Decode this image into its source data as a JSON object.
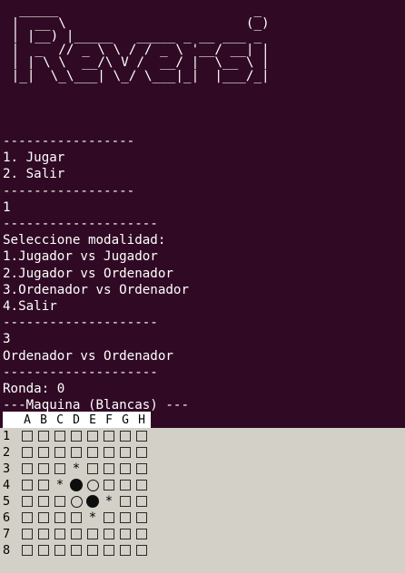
{
  "banner": "  _____                         _ \n |  __ \\                       (_)\n | |__) |_____   _____ _ __ ___ _ \n |  _  // _ \\ \\ / / _ \\ '__/ __| |\n | | \\ \\  __/\\ V /  __/ |  \\__ \\ |\n |_|  \\_\\___| \\_/ \\___|_|  |___/_|",
  "log": [
    "-----------------",
    "1. Jugar",
    "2. Salir",
    "-----------------",
    "1",
    "--------------------",
    "Seleccione modalidad:",
    "1.Jugador vs Jugador",
    "2.Jugador vs Ordenador",
    "3.Ordenador vs Ordenador",
    "4.Salir",
    "--------------------",
    "3",
    "Ordenador vs Ordenador",
    "--------------------",
    "Ronda: 0",
    "---Maquina (Blancas) ---"
  ],
  "board": {
    "columns": [
      "A",
      "B",
      "C",
      "D",
      "E",
      "F",
      "G",
      "H"
    ],
    "rows": [
      {
        "label": "1",
        "cells": [
          "empty",
          "empty",
          "empty",
          "empty",
          "empty",
          "empty",
          "empty",
          "empty"
        ]
      },
      {
        "label": "2",
        "cells": [
          "empty",
          "empty",
          "empty",
          "empty",
          "empty",
          "empty",
          "empty",
          "empty"
        ]
      },
      {
        "label": "3",
        "cells": [
          "empty",
          "empty",
          "empty",
          "hint",
          "empty",
          "empty",
          "empty",
          "empty"
        ]
      },
      {
        "label": "4",
        "cells": [
          "empty",
          "empty",
          "hint",
          "black",
          "white",
          "empty",
          "empty",
          "empty"
        ]
      },
      {
        "label": "5",
        "cells": [
          "empty",
          "empty",
          "empty",
          "white",
          "black",
          "hint",
          "empty",
          "empty"
        ]
      },
      {
        "label": "6",
        "cells": [
          "empty",
          "empty",
          "empty",
          "empty",
          "hint",
          "empty",
          "empty",
          "empty"
        ]
      },
      {
        "label": "7",
        "cells": [
          "empty",
          "empty",
          "empty",
          "empty",
          "empty",
          "empty",
          "empty",
          "empty"
        ]
      },
      {
        "label": "8",
        "cells": [
          "empty",
          "empty",
          "empty",
          "empty",
          "empty",
          "empty",
          "empty",
          "empty"
        ]
      }
    ],
    "hint_symbol": "*"
  },
  "colors": {
    "terminal_bg": "#300a24",
    "terminal_fg": "#ffffff",
    "board_bg": "#d3d0c8"
  }
}
